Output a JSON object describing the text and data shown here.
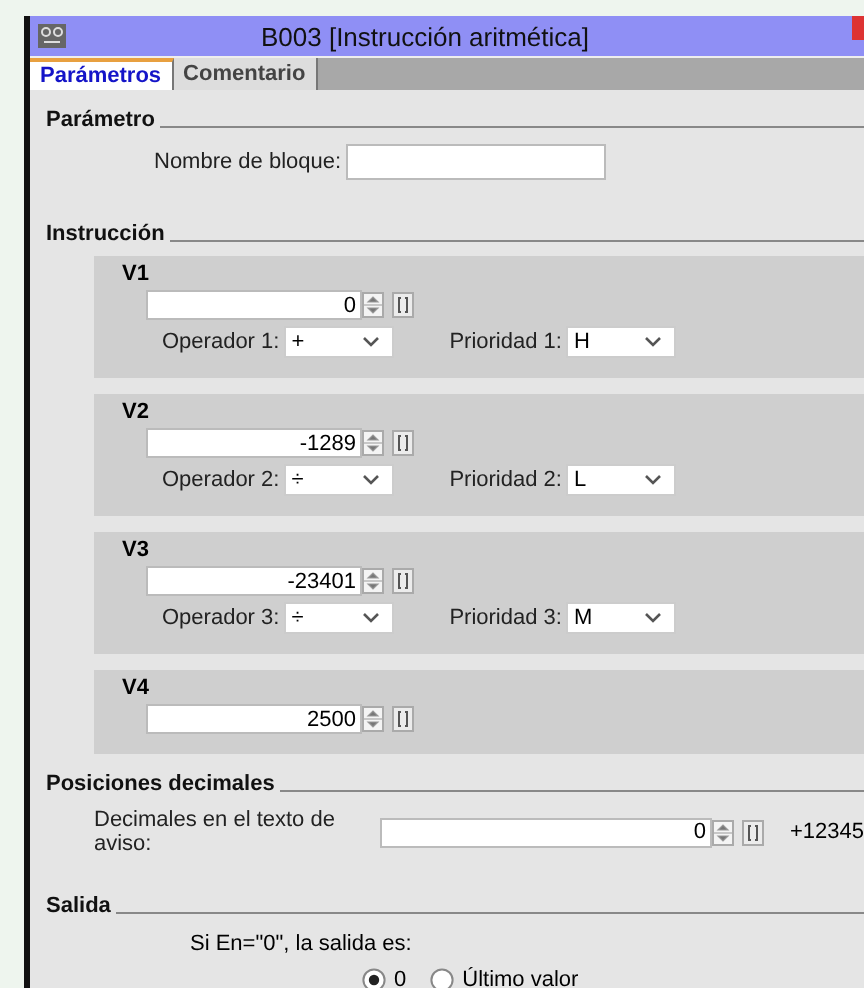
{
  "window": {
    "title": "B003 [Instrucción aritmética]"
  },
  "tabs": [
    {
      "label": "Parámetros",
      "selected": true
    },
    {
      "label": "Comentario",
      "selected": false
    }
  ],
  "parameter": {
    "title": "Parámetro",
    "field_label": "Nombre de bloque:"
  },
  "instruction": {
    "title": "Instrucción",
    "values": [
      {
        "name": "V1",
        "value": "0",
        "operator": {
          "label": "Operador 1:",
          "value": "+"
        },
        "priority": {
          "label": "Prioridad 1:",
          "value": "H"
        }
      },
      {
        "name": "V2",
        "value": "-1289",
        "operator": {
          "label": "Operador 2:",
          "value": "÷"
        },
        "priority": {
          "label": "Prioridad 2:",
          "value": "L"
        }
      },
      {
        "name": "V3",
        "value": "-23401",
        "operator": {
          "label": "Operador 3:",
          "value": "÷"
        },
        "priority": {
          "label": "Prioridad 3:",
          "value": "M"
        }
      },
      {
        "name": "V4",
        "value": "2500"
      }
    ]
  },
  "decimals": {
    "title": "Posiciones decimales",
    "label": "Decimales en el texto de aviso:",
    "value": "0",
    "preview": "+12345"
  },
  "output": {
    "title": "Salida",
    "prompt": "Si En=\"0\", la salida es:",
    "options": [
      {
        "label": "0",
        "selected": true
      },
      {
        "label": "Último valor",
        "selected": false
      }
    ]
  }
}
